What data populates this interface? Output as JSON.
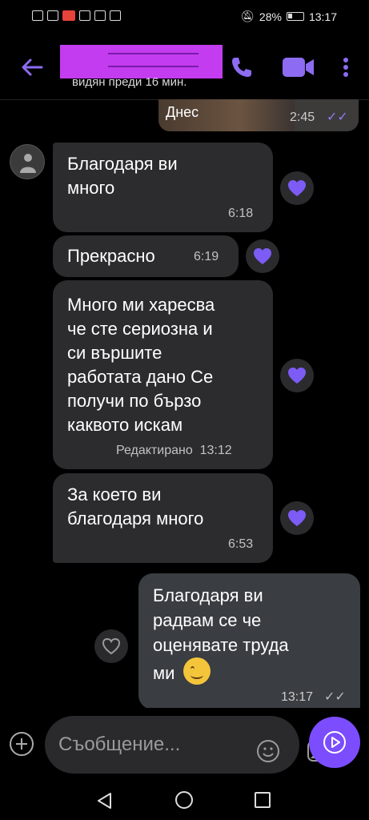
{
  "status_bar": {
    "battery": "28%",
    "time": "13:17"
  },
  "header": {
    "last_seen": "видян преди 16 мин."
  },
  "previous_message": {
    "text": "Днес",
    "time": "2:45"
  },
  "messages_in": [
    {
      "lines": [
        "Благодаря ви",
        "много"
      ],
      "time": "6:18"
    },
    {
      "lines": [
        "Прекрасно"
      ],
      "time": "6:19"
    },
    {
      "lines": [
        "Много ми харесва",
        "че сте сериозна и",
        "си вършите",
        "работата дано Се",
        "получи по бързо",
        "каквото искам"
      ],
      "time": "Редактирано  13:12"
    },
    {
      "lines": [
        "За което ви",
        "благодаря много"
      ],
      "time": "6:53"
    }
  ],
  "message_out": {
    "lines": [
      "Благодаря ви",
      "радвам се че",
      "оценявате труда",
      "ми"
    ],
    "time": "13:17"
  },
  "composer": {
    "placeholder": "Съобщение..."
  },
  "colors": {
    "accent": "#7c4dff",
    "bubble_in": "#2c2c2e",
    "bubble_out": "#3a3d41",
    "reaction": "#7c5cf5"
  }
}
